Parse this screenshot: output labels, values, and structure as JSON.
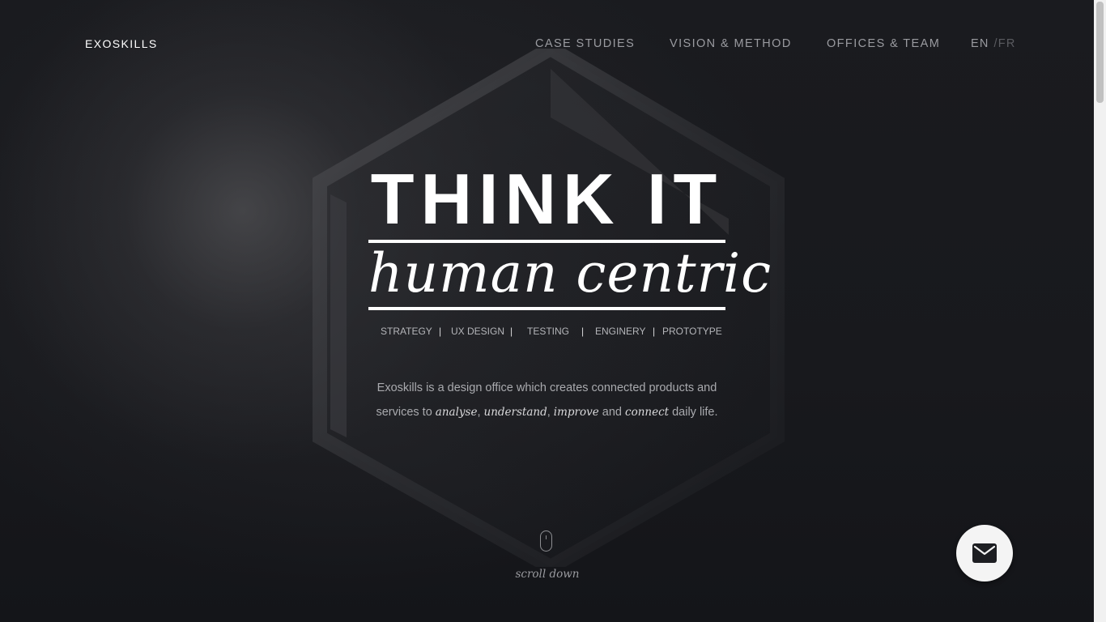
{
  "brand": {
    "logo": "EXOSKILLS"
  },
  "nav": {
    "items": [
      {
        "label": "CASE STUDIES"
      },
      {
        "label": "VISION & METHOD"
      },
      {
        "label": "OFFICES & TEAM"
      }
    ],
    "lang": {
      "en": "EN",
      "separator": "/",
      "fr": "FR",
      "active": "EN"
    }
  },
  "hero": {
    "title": "THINK IT",
    "subtitle": "human centric",
    "services": [
      "STRATEGY",
      "UX DESIGN",
      "TESTING",
      "ENGINERY",
      "PROTOTYPE"
    ],
    "service_separator": "|",
    "description": {
      "part1": "Exoskills is a design office which creates connected products and services to ",
      "em1": "analyse",
      "sep1": ", ",
      "em2": "understand",
      "sep2": ", ",
      "em3": "improve",
      "and": " and ",
      "em4": "connect",
      "part2": " daily life."
    }
  },
  "scroll": {
    "label": "scroll down",
    "icon": "mouse-icon"
  },
  "contact_button": {
    "icon": "mail-icon"
  },
  "colors": {
    "background": "#16171b",
    "text_primary": "#ffffff",
    "nav_text": "#9a9ba0",
    "fab_background": "#f4f4f4"
  }
}
